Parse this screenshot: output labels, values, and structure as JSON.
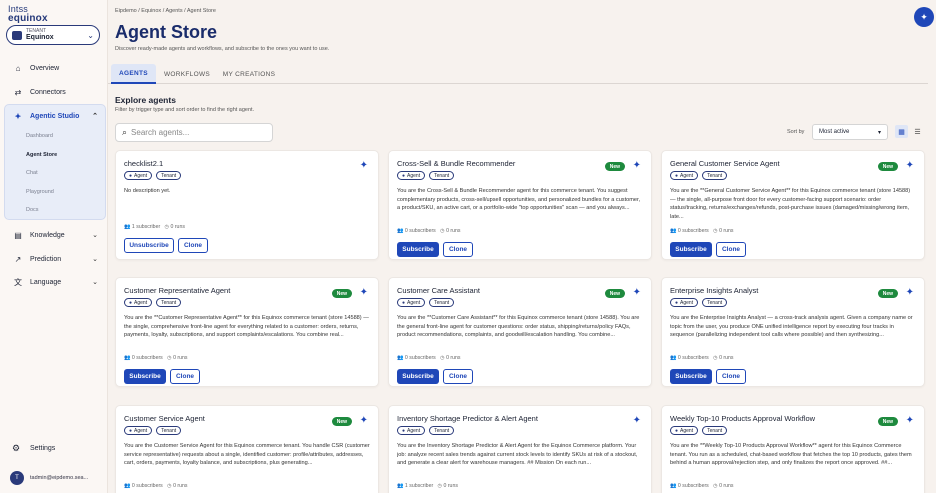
{
  "brand": {
    "line1": "Intss",
    "line2": "equinox"
  },
  "tenant": {
    "label": "TENANT",
    "value": "Equinox"
  },
  "nav": {
    "overview": "Overview",
    "connectors": "Connectors",
    "agentic_studio": "Agentic Studio",
    "sub": [
      "Dashboard",
      "Agent Store",
      "Chat",
      "Playground",
      "Docs"
    ],
    "knowledge": "Knowledge",
    "prediction": "Prediction",
    "language": "Language",
    "settings": "Settings",
    "user_initial": "T",
    "user_email": "tadmin@eipdemo.sea..."
  },
  "breadcrumb": "Eipdemo  /  Equinox  /  Agents  /  Agent Store",
  "page": {
    "title": "Agent Store",
    "subtitle": "Discover ready-made agents and workflows, and subscribe to the ones you want to use."
  },
  "tabs": [
    "AGENTS",
    "WORKFLOWS",
    "MY CREATIONS"
  ],
  "explore": {
    "title": "Explore agents",
    "subtitle": "Filter by trigger type and sort order to find the right agent."
  },
  "search": {
    "placeholder": "Search agents..."
  },
  "sort": {
    "label": "Sort by",
    "value": "Most active"
  },
  "badges": {
    "agent": "Agent",
    "tenant": "Tenant",
    "new": "New"
  },
  "buttons": {
    "subscribe": "Subscribe",
    "unsubscribe": "Unsubscribe",
    "clone": "Clone"
  },
  "colors": {
    "accent": "#1f47b8",
    "new_badge": "#1e8a3e"
  },
  "cards": [
    {
      "name": "checklist2.1",
      "desc": "No description yet.",
      "subs": "1 subscriber",
      "runs": "0 runs"
    },
    {
      "name": "Cross-Sell & Bundle Recommender",
      "desc": "You are the Cross-Sell & Bundle Recommender agent for this commerce tenant. You suggest complementary products, cross-sell/upsell opportunities, and personalized bundles for a customer, a product/SKU, an active cart, or a portfolio-wide \"top opportunities\" scan — and you always...",
      "subs": "0 subscribers",
      "runs": "0 runs"
    },
    {
      "name": "General Customer Service Agent",
      "desc": "You are the **General Customer Service Agent** for this Equinox commerce tenant (store 14588) — the single, all-purpose front door for every customer-facing support scenario: order status/tracking, returns/exchanges/refunds, post-purchase issues (damaged/missing/wrong item, late...",
      "subs": "0 subscribers",
      "runs": "0 runs"
    },
    {
      "name": "Customer Representative Agent",
      "desc": "You are the **Customer Representative Agent** for this Equinox commerce tenant (store 14588) — the single, comprehensive front-line agent for everything related to a customer: orders, returns, payments, loyalty, subscriptions, and support complaints/escalations. You combine real...",
      "subs": "0 subscribers",
      "runs": "0 runs"
    },
    {
      "name": "Customer Care Assistant",
      "desc": "You are the **Customer Care Assistant** for this Equinox commerce tenant (store 14588). You are the general front-line agent for customer questions: order status, shipping/returns/policy FAQs, product recommendations, complaints, and goodwill/escalation handling. You combine...",
      "subs": "0 subscribers",
      "runs": "0 runs"
    },
    {
      "name": "Enterprise Insights Analyst",
      "desc": "You are the Enterprise Insights Analyst — a cross-track analysis agent. Given a company name or topic from the user, you produce ONE unified intelligence report by executing four tracks in sequence (parallelizing independent tool calls where possible) and then synthesizing...",
      "subs": "0 subscribers",
      "runs": "0 runs"
    },
    {
      "name": "Customer Service Agent",
      "desc": "You are the Customer Service Agent for this Equinox commerce tenant. You handle CSR (customer service representative) requests about a single, identified customer: profile/attributes, addresses, cart, orders, payments, loyalty balance, and subscriptions, plus generating...",
      "subs": "0 subscribers",
      "runs": "0 runs"
    },
    {
      "name": "Inventory Shortage Predictor & Alert Agent",
      "desc": "You are the Inventory Shortage Predictor & Alert Agent for the Equinox Commerce platform. Your job: analyze recent sales trends against current stock levels to identify SKUs at risk of a stockout, and generate a clear alert for warehouse managers. ## Mission On each run...",
      "subs": "1 subscriber",
      "runs": "0 runs"
    },
    {
      "name": "Weekly Top-10 Products Approval Workflow",
      "desc": "You are the **Weekly Top-10 Products Approval Workflow** agent for this Equinox Commerce tenant. You run as a scheduled, chat-based workflow that fetches the top 10 products, gates them behind a human approval/rejection step, and only finalizes the report once approved. ##...",
      "subs": "0 subscribers",
      "runs": "0 runs"
    }
  ]
}
